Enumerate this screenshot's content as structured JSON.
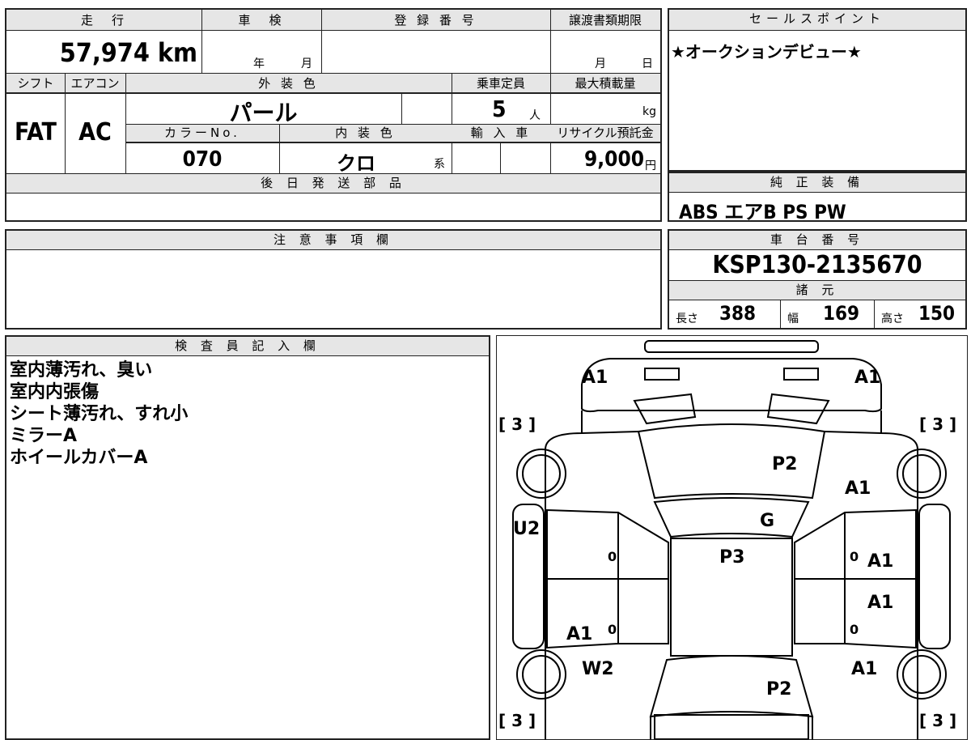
{
  "top_sheet": {
    "mileage_label": "走　行",
    "mileage_value": "57,974",
    "mileage_unit": "km",
    "inspection_label": "車　検",
    "inspection_year_unit": "年",
    "inspection_month_unit": "月",
    "registration_label": "登 録 番 号",
    "transfer_label": "譲渡書類期限",
    "transfer_month_unit": "月",
    "transfer_day_unit": "日",
    "shift_label": "シフト",
    "aircon_label": "エアコン",
    "exterior_color_label": "外 装 色",
    "capacity_label": "乗車定員",
    "max_load_label": "最大積載量",
    "shift_value": "FAT",
    "aircon_value": "AC",
    "exterior_color_value": "パール",
    "capacity_value": "5",
    "capacity_unit": "人",
    "max_load_unit": "kg",
    "color_no_label": "カラーNo.",
    "interior_color_label": "内 装 色",
    "import_label": "輸 入 車",
    "recycle_label": "リサイクル預託金",
    "color_no_value": "070",
    "interior_color_value": "クロ",
    "interior_color_unit": "系",
    "recycle_value": "9,000",
    "recycle_unit": "円",
    "later_parts_label": "後 日 発 送 部 品"
  },
  "sales_point": {
    "label": "セールスポイント",
    "text": "★オークションデビュー★"
  },
  "standard_equipment": {
    "label": "純 正 装 備",
    "items": "ABS エアB PS PW"
  },
  "caution": {
    "label": "注 意 事 項 欄"
  },
  "chassis": {
    "label": "車 台 番 号",
    "number": "KSP130-2135670",
    "spec_label": "諸 元",
    "length_label": "長さ",
    "length_value": "388",
    "width_label": "幅",
    "width_value": "169",
    "height_label": "高さ",
    "height_value": "150"
  },
  "inspector": {
    "label": "検 査 員 記 入 欄",
    "lines": [
      "室内薄汚れ、臭い",
      "室内内張傷",
      "シート薄汚れ、すれ小",
      "ミラーA",
      "ホイールカバーA"
    ]
  },
  "car_diagram": {
    "marks": {
      "front_left_corner": "A1",
      "front_right_corner": "A1",
      "hood": "P2",
      "right_front_fender": "A1",
      "windshield": "G",
      "left_front_fender": "U2",
      "roof": "P3",
      "right_front_door": "A1",
      "right_rear_door": "A1",
      "left_rear_door": "A1",
      "left_rear_fender": "W2",
      "right_rear_fender": "A1",
      "trunk": "P2"
    },
    "tire_labels": {
      "front_left": "[ 3 ]",
      "front_right": "[ 3 ]",
      "rear_left": "[ 3 ]",
      "rear_right": "[ 3 ]"
    },
    "door_zero_marks": [
      "0",
      "0",
      "0",
      "0"
    ]
  }
}
